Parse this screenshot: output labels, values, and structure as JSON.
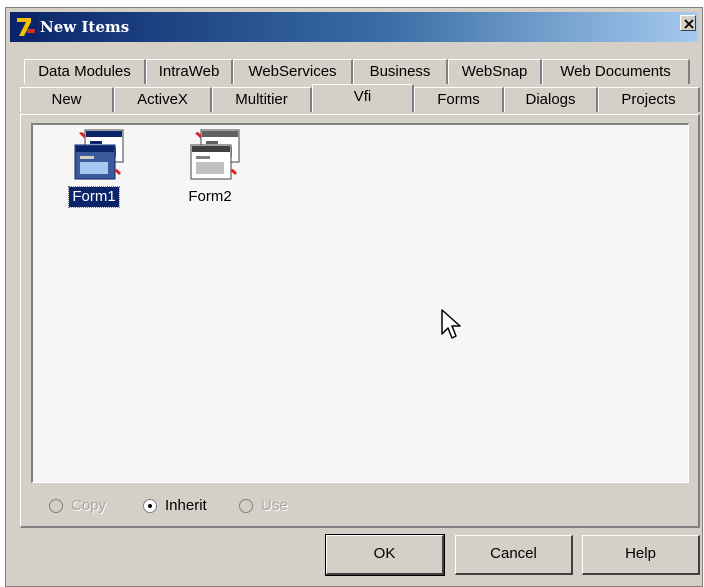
{
  "window": {
    "title": "New Items",
    "app_icon_text": "7",
    "colors": {
      "titlebar_start": "#0a246a",
      "titlebar_end": "#a6caf0",
      "face": "#d4d0c8",
      "view_bg": "#f6f6f6",
      "selection": "#0a246a"
    }
  },
  "tabs": {
    "row1": [
      "Data Modules",
      "IntraWeb",
      "WebServices",
      "Business",
      "WebSnap",
      "Web Documents"
    ],
    "row2": [
      "New",
      "ActiveX",
      "Multitier",
      "Vfi",
      "Forms",
      "Dialogs",
      "Projects"
    ],
    "active": "Vfi"
  },
  "items": [
    {
      "label": "Form1",
      "icon": "form-icon",
      "selected": true
    },
    {
      "label": "Form2",
      "icon": "form-icon",
      "selected": false
    }
  ],
  "options": {
    "copy_label": "Copy",
    "inherit_label": "Inherit",
    "use_label": "Use",
    "selected": "Inherit"
  },
  "buttons": {
    "ok_label": "OK",
    "cancel_label": "Cancel",
    "help_label": "Help"
  }
}
